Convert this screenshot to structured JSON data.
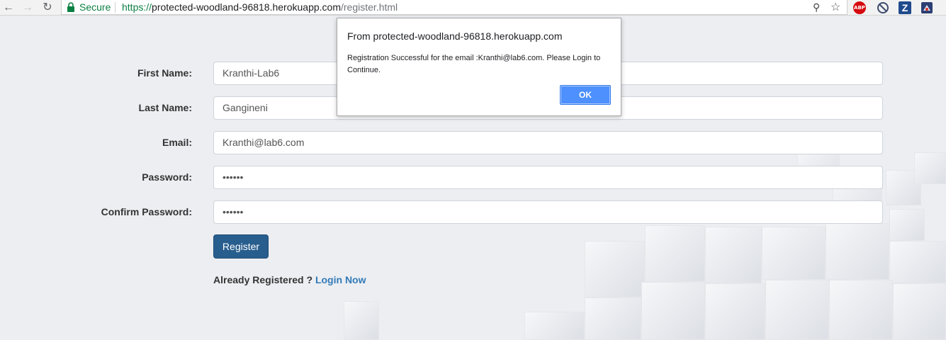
{
  "browser": {
    "secure_label": "Secure",
    "url_scheme": "https://",
    "url_host": "protected-woodland-96818.herokuapp.com",
    "url_path": "/register.html",
    "extensions": {
      "abp_label": "ABP",
      "z_label": "Z"
    }
  },
  "form": {
    "first_name_label": "First Name:",
    "first_name_value": "Kranthi-Lab6",
    "last_name_label": "Last Name:",
    "last_name_value": "Gangineni",
    "email_label": "Email:",
    "email_value": "Kranthi@lab6.com",
    "password_label": "Password:",
    "password_value": "••••••",
    "confirm_password_label": "Confirm Password:",
    "confirm_password_value": "••••••",
    "register_label": "Register",
    "already_registered": "Already Registered ?",
    "login_now": "Login Now"
  },
  "dialog": {
    "title": "From protected-woodland-96818.herokuapp.com",
    "message": "Registration Successful for the email :Kranthi@lab6.com. Please Login to Continue.",
    "ok_label": "OK"
  },
  "colors": {
    "register_button": "#285e8e",
    "ok_button": "#4d90fe",
    "link": "#337ab7",
    "secure": "#0b8043"
  }
}
